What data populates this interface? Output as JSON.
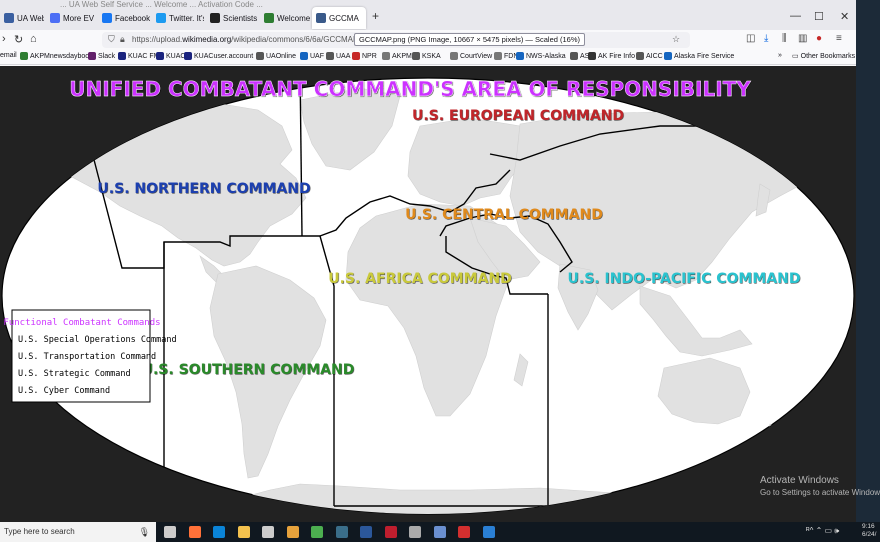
{
  "browser": {
    "ghost_title": "... UA Web Self Service ... Welcome ... Activation Code ...",
    "tabs": [
      {
        "label": "UA Web SS",
        "color": "#3a5fa0"
      },
      {
        "label": "More EV Ch",
        "color": "#4c6ef5"
      },
      {
        "label": "Facebook -",
        "color": "#1877f2"
      },
      {
        "label": "Twitter. It's",
        "color": "#1d9bf0"
      },
      {
        "label": "Scientists Fi",
        "color": "#222222"
      },
      {
        "label": "Welcome to",
        "color": "#2e7d32"
      },
      {
        "label": "GCCMA",
        "color": "#3a5a8a"
      }
    ],
    "new_tab": "+",
    "window_controls": {
      "minimize": "—",
      "maximize": "☐",
      "close": "✕"
    },
    "url_prefix": "https://upload.",
    "url_domain": "wikimedia.org",
    "url_path": "/wikipedia/commons/6/6a/GCCMAP.png",
    "url_chip": "GCCMAP.png (PNG Image, 10667 × 5475 pixels) — Scaled (16%)",
    "bookmarks": [
      {
        "label": "email",
        "color": "#888888"
      },
      {
        "label": "AKPMnewsdaybook",
        "color": "#2e7d32"
      },
      {
        "label": "Slack",
        "color": "#611f69"
      },
      {
        "label": "KUAC FM",
        "color": "#1a237e"
      },
      {
        "label": "KUAC",
        "color": "#1a237e"
      },
      {
        "label": "KUACuser.account",
        "color": "#1a237e"
      },
      {
        "label": "UAOnline",
        "color": "#555555"
      },
      {
        "label": "UAF",
        "color": "#1565c0"
      },
      {
        "label": "UAA",
        "color": "#555555"
      },
      {
        "label": "NPR",
        "color": "#c62828"
      },
      {
        "label": "AKPM",
        "color": "#777777"
      },
      {
        "label": "KSKA",
        "color": "#555555"
      },
      {
        "label": "CourtView",
        "color": "#777777"
      },
      {
        "label": "FDNM",
        "color": "#777777"
      },
      {
        "label": "NWS-Alaska",
        "color": "#1565c0"
      },
      {
        "label": "AST",
        "color": "#555555"
      },
      {
        "label": "AK Fire Info",
        "color": "#333333"
      },
      {
        "label": "AICC",
        "color": "#555555"
      },
      {
        "label": "Alaska Fire Service",
        "color": "#1565c0"
      }
    ],
    "other_bookmarks": "Other Bookmarks"
  },
  "map": {
    "title": "UNIFIED COMBATANT COMMAND'S AREA OF RESPONSIBILITY",
    "title_color": "#cc33ff",
    "commands": [
      {
        "label": "U.S. NORTHERN COMMAND",
        "color": "#1f3fb0"
      },
      {
        "label": "U.S. EUROPEAN COMMAND",
        "color": "#c0262c"
      },
      {
        "label": "U.S. CENTRAL COMMAND",
        "color": "#e08a1e"
      },
      {
        "label": "U.S. AFRICA COMMAND",
        "color": "#c9c93a"
      },
      {
        "label": "U.S. INDO-PACIFIC COMMAND",
        "color": "#29c3cf"
      },
      {
        "label": "U.S. SOUTHERN COMMAND",
        "color": "#2a8a2a"
      }
    ],
    "functional": {
      "heading": "Functional Combatant Commands",
      "heading_color": "#cc33ff",
      "items": [
        "U.S. Special Operations Command",
        "U.S. Transportation Command",
        "U.S. Strategic Command",
        "U.S. Cyber Command"
      ]
    }
  },
  "watermark": {
    "line1": "Activate Windows",
    "line2": "Go to Settings to activate Windows."
  },
  "taskbar": {
    "search_placeholder": "Type here to search",
    "apps": [
      {
        "name": "task-view",
        "color": "#cccccc"
      },
      {
        "name": "firefox",
        "color": "#ff7139"
      },
      {
        "name": "edge",
        "color": "#0a84d8"
      },
      {
        "name": "file-explorer",
        "color": "#f2c14e"
      },
      {
        "name": "store",
        "color": "#cccccc"
      },
      {
        "name": "media",
        "color": "#e6a23c"
      },
      {
        "name": "chrome",
        "color": "#4caf50"
      },
      {
        "name": "terminal",
        "color": "#3a6e8a"
      },
      {
        "name": "word",
        "color": "#2b579a"
      },
      {
        "name": "filezilla",
        "color": "#bf1e2e"
      },
      {
        "name": "mail",
        "color": "#aaaaaa"
      },
      {
        "name": "network",
        "color": "#6a8fcf"
      },
      {
        "name": "acrobat",
        "color": "#d32f2f"
      },
      {
        "name": "photos",
        "color": "#2a7fd4"
      }
    ],
    "tray": "ᴿ^ ⌃ ▭ 🕪",
    "time": "9:16",
    "date": "6/24/"
  }
}
